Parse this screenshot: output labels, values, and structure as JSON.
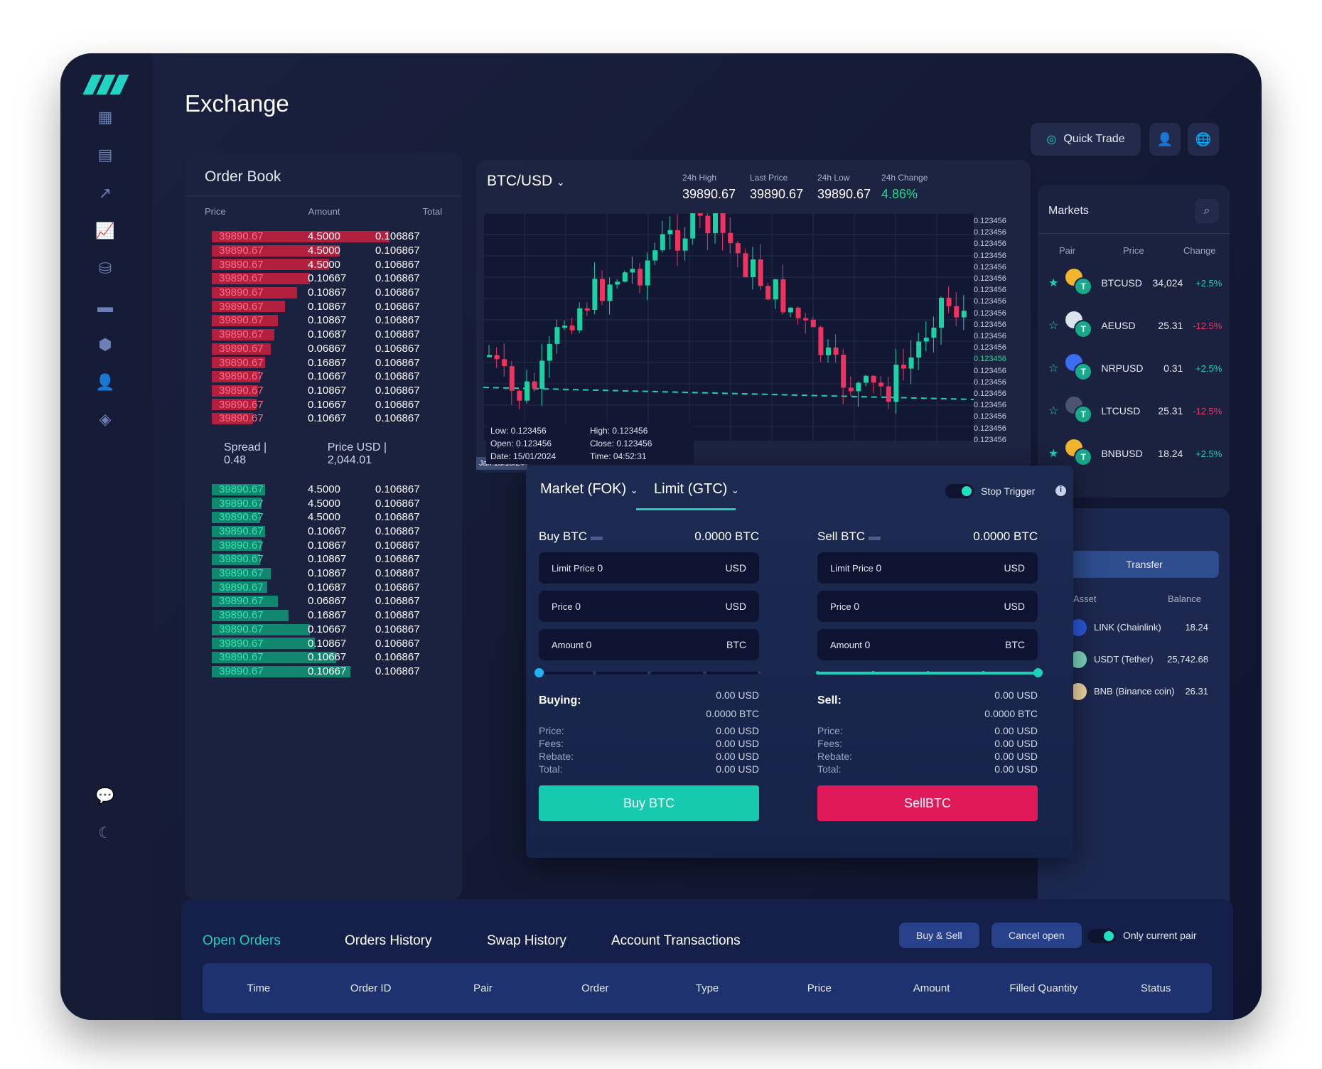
{
  "header": {
    "title": "Exchange",
    "quick_trade": "Quick Trade"
  },
  "colors": {
    "accent": "#1fcfb7",
    "sell": "#e0195a",
    "buy": "#17c9ae"
  },
  "sidebar": {
    "icons": [
      "dashboard-icon",
      "bar-chart-icon",
      "trend-icon",
      "line-chart-icon",
      "database-icon",
      "wallet-icon",
      "token-icon",
      "add-user-icon",
      "compass-icon",
      "chat-icon",
      "moon-icon"
    ]
  },
  "orderbook": {
    "title": "Order Book",
    "headers": [
      "Price",
      "Amount",
      "Total"
    ],
    "asks": [
      [
        "39890.67",
        "4.5000",
        "0.106867"
      ],
      [
        "39890.67",
        "4.5000",
        "0.106867"
      ],
      [
        "39890.67",
        "4.5000",
        "0.106867"
      ],
      [
        "39890.67",
        "0.10667",
        "0.106867"
      ],
      [
        "39890.67",
        "0.10867",
        "0.106867"
      ],
      [
        "39890.67",
        "0.10867",
        "0.106867"
      ],
      [
        "39890.67",
        "0.10867",
        "0.106867"
      ],
      [
        "39890.67",
        "0.10687",
        "0.106867"
      ],
      [
        "39890.67",
        "0.06867",
        "0.106867"
      ],
      [
        "39890.67",
        "0.16867",
        "0.106867"
      ],
      [
        "39890.67",
        "0.10667",
        "0.106867"
      ],
      [
        "39890.67",
        "0.10867",
        "0.106867"
      ],
      [
        "39890.67",
        "0.10667",
        "0.106867"
      ],
      [
        "39890.67",
        "0.10667",
        "0.106867"
      ]
    ],
    "bids": [
      [
        "39890.67",
        "4.5000",
        "0.106867"
      ],
      [
        "39890.67",
        "4.5000",
        "0.106867"
      ],
      [
        "39890.67",
        "4.5000",
        "0.106867"
      ],
      [
        "39890.67",
        "0.10667",
        "0.106867"
      ],
      [
        "39890.67",
        "0.10867",
        "0.106867"
      ],
      [
        "39890.67",
        "0.10867",
        "0.106867"
      ],
      [
        "39890.67",
        "0.10867",
        "0.106867"
      ],
      [
        "39890.67",
        "0.10687",
        "0.106867"
      ],
      [
        "39890.67",
        "0.06867",
        "0.106867"
      ],
      [
        "39890.67",
        "0.16867",
        "0.106867"
      ],
      [
        "39890.67",
        "0.10667",
        "0.106867"
      ],
      [
        "39890.67",
        "0.10867",
        "0.106867"
      ],
      [
        "39890.67",
        "0.10667",
        "0.106867"
      ],
      [
        "39890.67",
        "0.10667",
        "0.106867"
      ]
    ],
    "ask_depth": [
      1.0,
      0.72,
      0.66,
      0.55,
      0.48,
      0.41,
      0.37,
      0.35,
      0.33,
      0.3,
      0.27,
      0.26,
      0.25,
      0.23
    ],
    "bid_depth": [
      0.3,
      0.28,
      0.27,
      0.3,
      0.28,
      0.27,
      0.33,
      0.31,
      0.37,
      0.43,
      0.55,
      0.58,
      0.7,
      0.78
    ],
    "spread": "Spread | 0.48",
    "price_usd": "Price USD | 2,044.01"
  },
  "chart": {
    "pair": "BTC/USD",
    "stats": [
      {
        "label": "24h High",
        "value": "39890.67"
      },
      {
        "label": "Last Price",
        "value": "39890.67"
      },
      {
        "label": "24h Low",
        "value": "39890.67"
      },
      {
        "label": "24h Change",
        "value": "4.86%"
      }
    ],
    "y_label": "0.123456",
    "ohlc": {
      "low": "Low: 0.123456",
      "high": "High: 0.123456",
      "open": "Open: 0.123456",
      "close": "Close: 0.123456",
      "date": "Date: 15/01/2024",
      "time": "Time: 04:52:31"
    },
    "x_label": "Jan 15/10/24"
  },
  "markets": {
    "title": "Markets",
    "headers": [
      "Pair",
      "Price",
      "Change"
    ],
    "rows": [
      {
        "pair": "BTCUSD",
        "price": "34,024",
        "change": "+2.5%",
        "fav": true,
        "color": "#f3b52b"
      },
      {
        "pair": "AEUSD",
        "price": "25.31",
        "change": "-12.5%",
        "fav": false,
        "color": "#d9e4ea"
      },
      {
        "pair": "NRPUSD",
        "price": "0.31",
        "change": "+2.5%",
        "fav": false,
        "color": "#3a6df0"
      },
      {
        "pair": "LTCUSD",
        "price": "25.31",
        "change": "-12.5%",
        "fav": false,
        "color": "#4a5470"
      },
      {
        "pair": "BNBUSD",
        "price": "18.24",
        "change": "+2.5%",
        "fav": true,
        "color": "#f3b52b"
      }
    ]
  },
  "assets": {
    "transfer": "Transfer",
    "headers": [
      "Asset",
      "Balance"
    ],
    "rows": [
      {
        "name": "LINK (Chainlink)",
        "balance": "18.24",
        "color": "#2a5ada"
      },
      {
        "name": "USDT (Tether)",
        "balance": "25,742.68",
        "color": "#7fd9c4"
      },
      {
        "name": "BNB (Binance coin)",
        "balance": "26.31",
        "color": "#f5d9a8"
      }
    ]
  },
  "trade": {
    "tabs": [
      "Market (FOK)",
      "Limit (GTC)"
    ],
    "stop_trigger": "Stop Trigger",
    "buy": {
      "title": "Buy BTC",
      "balance": "0.0000 BTC",
      "fields": [
        {
          "label": "Limit Price",
          "value": "0",
          "unit": "USD"
        },
        {
          "label": "Price",
          "value": "0",
          "unit": "USD"
        },
        {
          "label": "Amount",
          "value": "0",
          "unit": "BTC"
        }
      ],
      "slider": 0,
      "summary_title": "Buying:",
      "summary_usd": "0.00 USD",
      "summary_btc": "0.0000 BTC",
      "lines": [
        {
          "k": "Price:",
          "v": "0.00 USD"
        },
        {
          "k": "Fees:",
          "v": "0.00 USD"
        },
        {
          "k": "Rebate:",
          "v": "0.00 USD"
        },
        {
          "k": "Total:",
          "v": "0.00 USD"
        }
      ],
      "button": "Buy BTC"
    },
    "sell": {
      "title": "Sell BTC",
      "balance": "0.0000 BTC",
      "fields": [
        {
          "label": "Limit Price",
          "value": "0",
          "unit": "USD"
        },
        {
          "label": "Price",
          "value": "0",
          "unit": "USD"
        },
        {
          "label": "Amount",
          "value": "0",
          "unit": "BTC"
        }
      ],
      "slider": 100,
      "summary_title": "Sell:",
      "summary_usd": "0.00 USD",
      "summary_btc": "0.0000 BTC",
      "lines": [
        {
          "k": "Price:",
          "v": "0.00 USD"
        },
        {
          "k": "Fees:",
          "v": "0.00 USD"
        },
        {
          "k": "Rebate:",
          "v": "0.00 USD"
        },
        {
          "k": "Total:",
          "v": "0.00 USD"
        }
      ],
      "button": "SellBTC"
    }
  },
  "orders": {
    "tabs": [
      "Open Orders",
      "Orders History",
      "Swap History",
      "Account Transactions"
    ],
    "buttons": [
      "Buy & Sell",
      "Cancel open"
    ],
    "toggle": "Only current pair",
    "columns": [
      "Time",
      "Order ID",
      "Pair",
      "Order",
      "Type",
      "Price",
      "Amount",
      "Filled Quantity",
      "Status"
    ]
  }
}
